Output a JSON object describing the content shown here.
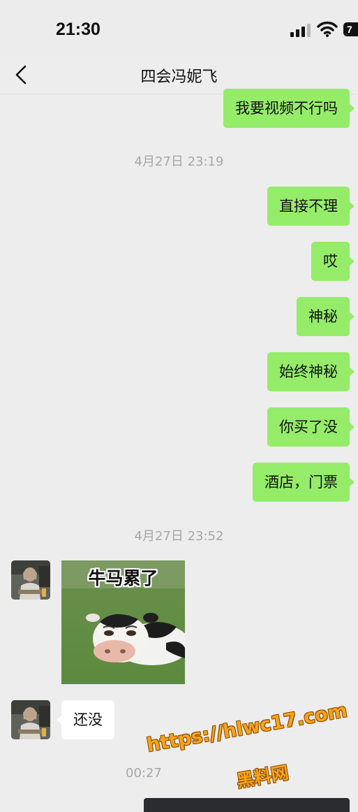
{
  "status_bar": {
    "time": "21:30",
    "battery": "7",
    "icons": [
      "signal-icon",
      "wifi-icon",
      "battery-icon"
    ]
  },
  "nav": {
    "back_icon": "chevron-left-icon",
    "title": "四会冯妮飞"
  },
  "messages": [
    {
      "side": "sent",
      "text": "我要视频不行吗"
    },
    {
      "type": "time",
      "text": "4月27日 23:19"
    },
    {
      "side": "sent",
      "text": "直接不理"
    },
    {
      "side": "sent",
      "text": "哎"
    },
    {
      "side": "sent",
      "text": "神秘"
    },
    {
      "side": "sent",
      "text": "始终神秘"
    },
    {
      "side": "sent",
      "text": "你买了没"
    },
    {
      "side": "sent",
      "text": "酒店，门票"
    },
    {
      "type": "time",
      "text": "4月27日 23:52"
    },
    {
      "side": "received",
      "type": "sticker",
      "caption": "牛马累了"
    },
    {
      "side": "received",
      "text": "还没"
    },
    {
      "type": "time",
      "text": "00:27"
    }
  ],
  "watermark": {
    "url": "https://hlwc17.com",
    "site": "黑料网"
  },
  "colors": {
    "background": "#ededed",
    "sent_bubble": "#95ec69",
    "received_bubble": "#ffffff",
    "timestamp": "#a7a7a7",
    "watermark": "#f7a31a"
  }
}
